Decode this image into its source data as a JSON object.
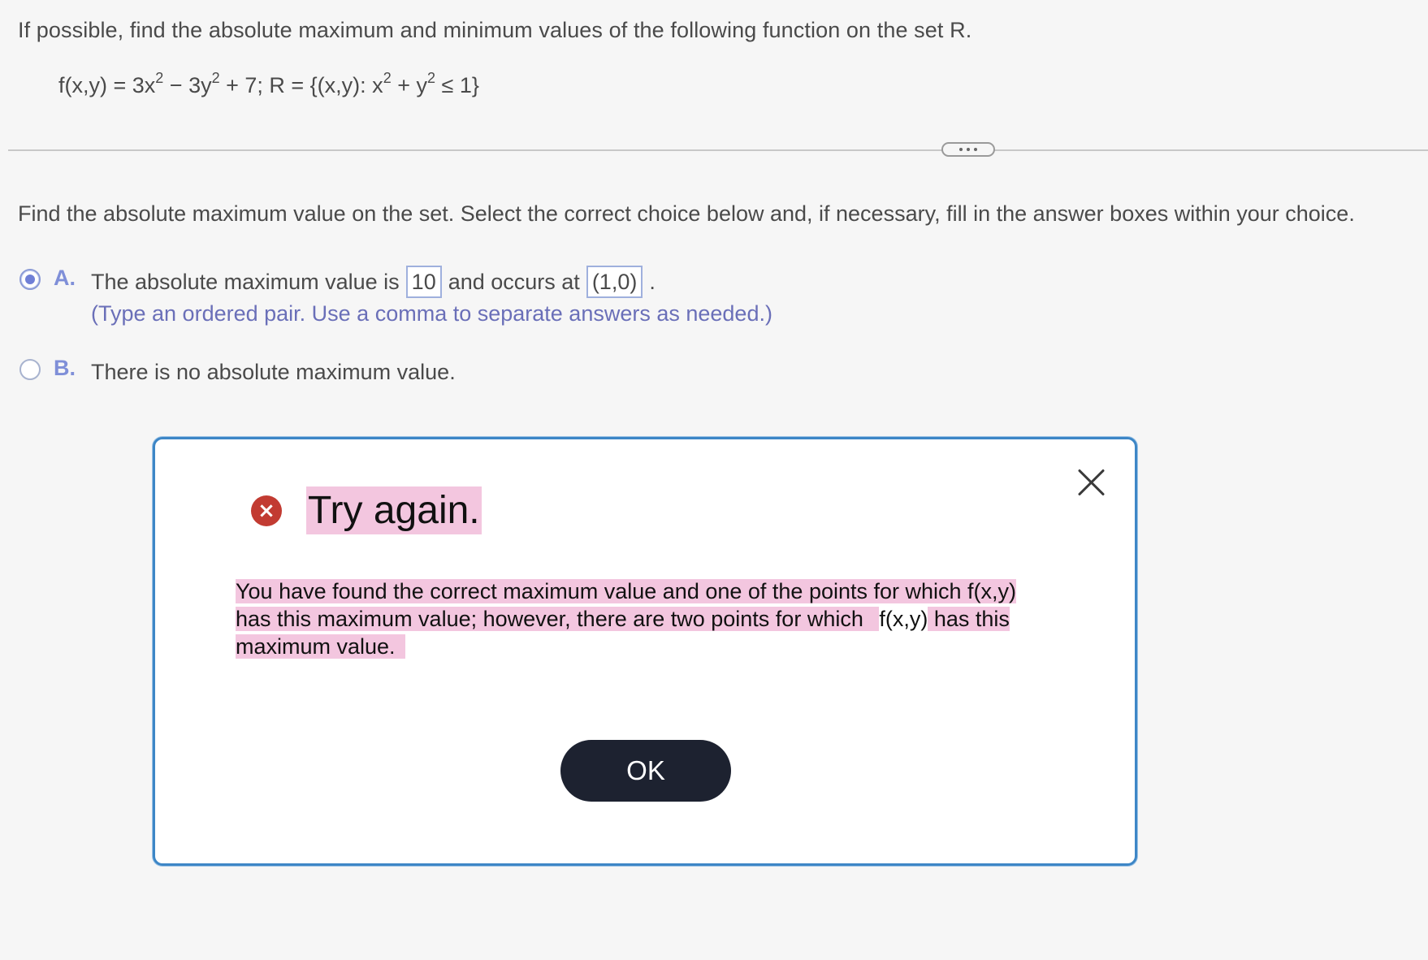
{
  "question": {
    "prompt": "If possible, find the absolute maximum and minimum values of the following function on the set R.",
    "formula": {
      "p1": "f(x,y) = 3x",
      "exp1": "2",
      "p2": " − 3y",
      "exp2": "2",
      "p3": " + 7; R = {(x,y): x",
      "exp3": "2",
      "p4": " + y",
      "exp4": "2",
      "p5": " ≤ 1}"
    },
    "instruction": "Find the absolute maximum value on the set. Select the correct choice below and, if necessary, fill in the answer boxes within your choice."
  },
  "choices": {
    "a": {
      "letter": "A.",
      "text_before": "The absolute maximum value is",
      "value": "10",
      "text_middle": "and occurs at",
      "point": "(1,0)",
      "text_after": ".",
      "hint": "(Type an ordered pair. Use a comma to separate answers as needed.)",
      "selected": true
    },
    "b": {
      "letter": "B.",
      "text": "There is no absolute maximum value.",
      "selected": false
    }
  },
  "modal": {
    "title": "Try again.",
    "message_part1": "You have found the correct maximum value and one of the points for which f(x,y) has this maximum value; however, there are two points for which ",
    "message_fx": "f(x,y)",
    "message_part2": " has this maximum value.",
    "ok_label": "OK",
    "error_icon": "×"
  },
  "colors": {
    "modal_border": "#3d86c6",
    "highlight": "#f3c6df",
    "ok_button": "#1d2230",
    "error_icon": "#c23b32",
    "choice_letter": "#7f8fd8",
    "hint": "#6a6fb8"
  }
}
